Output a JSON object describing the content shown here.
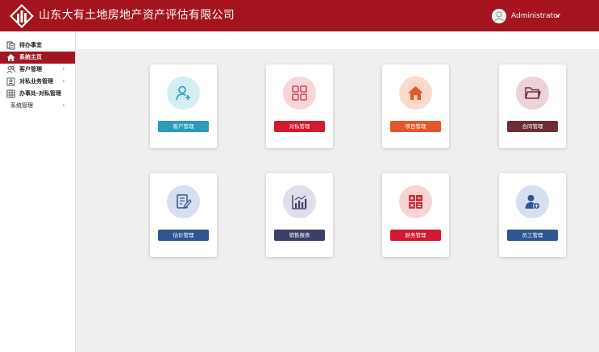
{
  "header": {
    "title": "山东大有土地房地产资产评估有限公司",
    "user_name": "Administrator",
    "bg_color": "#a4141e"
  },
  "sidebar": {
    "items": [
      {
        "label": "待办事宜",
        "icon": "todo-icon"
      },
      {
        "label": "系统主页",
        "icon": "home-icon",
        "active": true
      },
      {
        "label": "客户管理",
        "icon": "customers-icon",
        "has_children": true
      },
      {
        "label": "对私业务管理",
        "icon": "contact-card-icon",
        "has_children": true
      },
      {
        "label": "办事处-对私管理",
        "icon": "grid-table-icon"
      },
      {
        "label": "系统管理",
        "has_children": true
      }
    ]
  },
  "cards": [
    {
      "label": "客户管理",
      "icon": "add-user-icon",
      "circle_color": "#d4eef2",
      "button_color": "#2a9bb8",
      "icon_color": "#2a9bb8"
    },
    {
      "label": "对私管理",
      "icon": "grid-icon",
      "circle_color": "#f7d5d8",
      "button_color": "#d3192d",
      "icon_color": "#c8303c"
    },
    {
      "label": "项目管理",
      "icon": "home-icon",
      "circle_color": "#fbdacb",
      "button_color": "#e3582a",
      "icon_color": "#e3582a"
    },
    {
      "label": "合同管理",
      "icon": "folder-icon",
      "circle_color": "#ecd3d8",
      "button_color": "#6e2d35",
      "icon_color": "#6e2d35"
    },
    {
      "label": "估价管理",
      "icon": "edit-document-icon",
      "circle_color": "#d6dff0",
      "button_color": "#2e5690",
      "icon_color": "#2e5690"
    },
    {
      "label": "销售报表",
      "icon": "bar-chart-icon",
      "circle_color": "#dfdfec",
      "button_color": "#3b3e6a",
      "icon_color": "#3b3e6a"
    },
    {
      "label": "财务管理",
      "icon": "calculator-icon",
      "circle_color": "#f7d3d5",
      "button_color": "#d3192d",
      "icon_color": "#c8303c"
    },
    {
      "label": "员工管理",
      "icon": "add-employee-icon",
      "circle_color": "#d6dff0",
      "button_color": "#2e5690",
      "icon_color": "#2e5690"
    }
  ]
}
